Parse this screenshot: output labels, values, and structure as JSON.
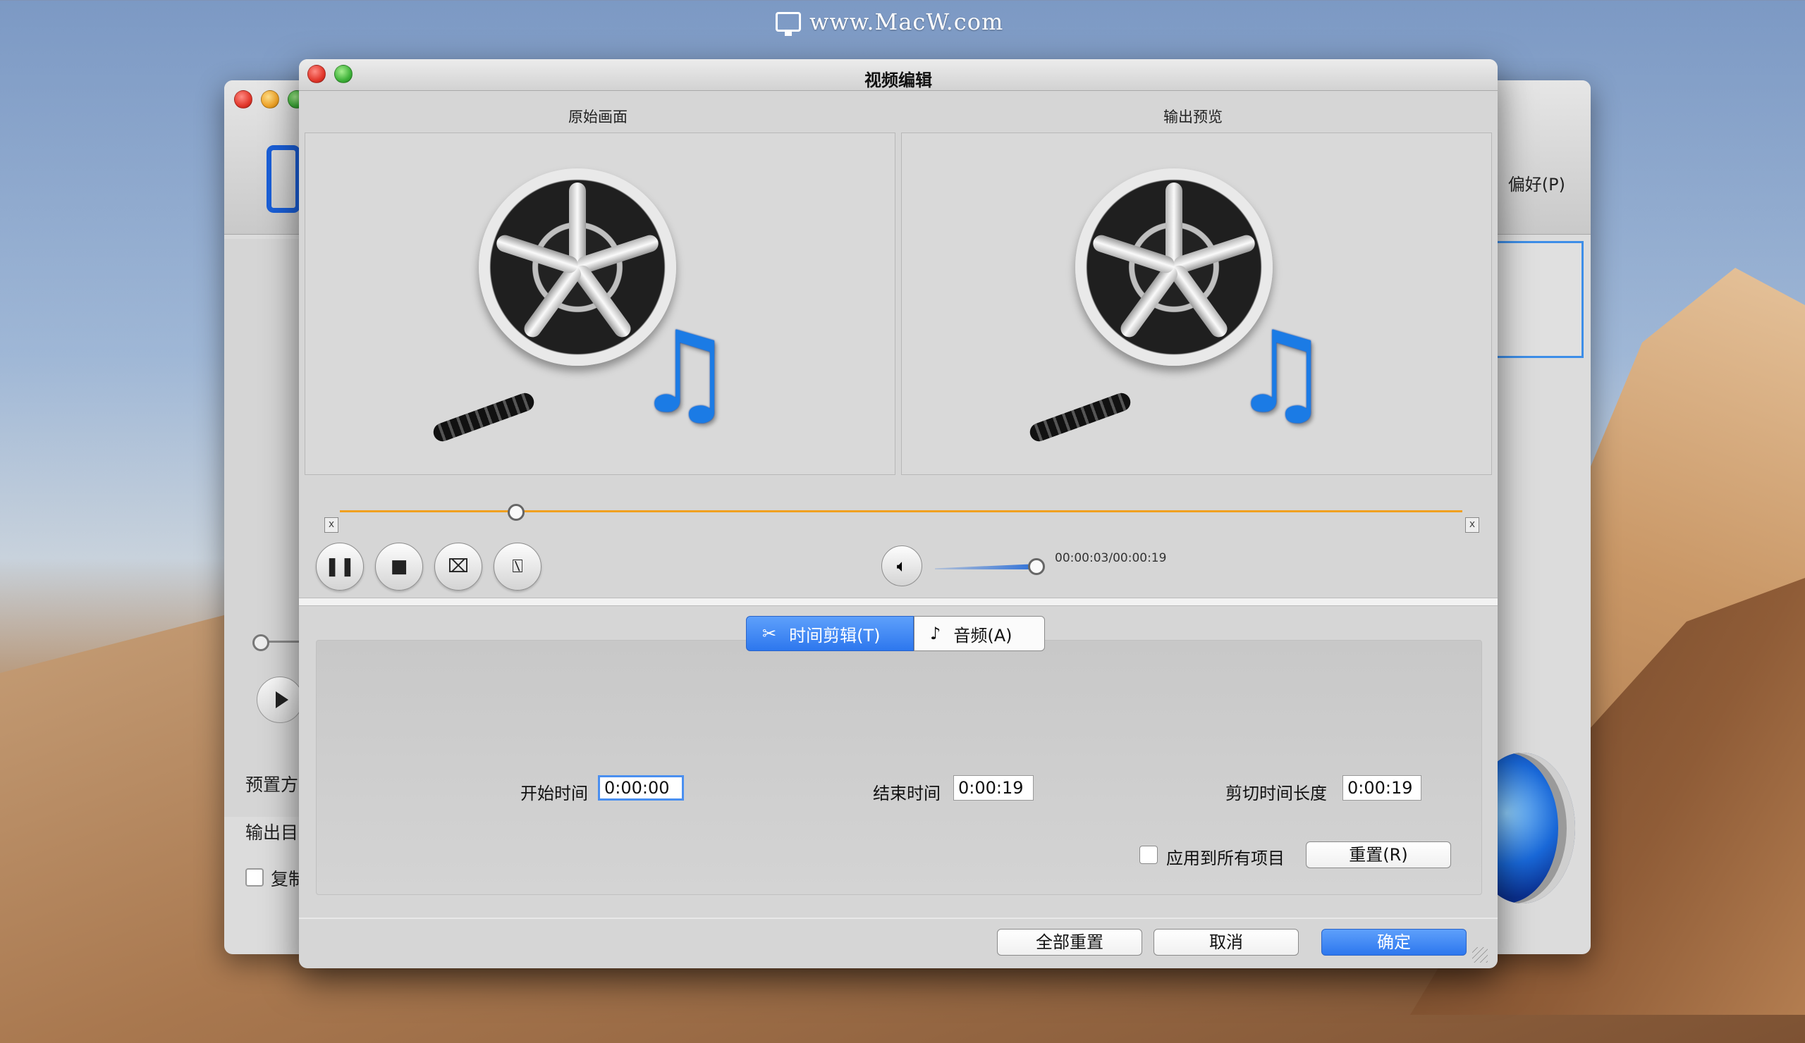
{
  "watermark": {
    "text": "www.MacW.com"
  },
  "background_window": {
    "preferences_label": "偏好(P)",
    "labels": [
      "预置方",
      "输出目",
      "复制"
    ]
  },
  "dialog": {
    "title": "视频编辑",
    "panes": {
      "original_label": "原始画面",
      "preview_label": "输出预览"
    },
    "seek": {
      "progress_fraction": 0.157
    },
    "trim_marker": "x",
    "controls": {
      "pause_icon": "pause-icon",
      "stop_icon": "stop-icon",
      "trim_start_icon": "trim-start-icon",
      "trim_end_icon": "trim-end-icon",
      "volume_icon": "speaker-icon",
      "volume_fraction": 0.95,
      "timecode": "00:00:03/00:00:19"
    },
    "tabs": [
      {
        "label": "时间剪辑(T)",
        "icon": "scissors-icon",
        "active": true
      },
      {
        "label": "音频(A)",
        "icon": "music-note-icon",
        "active": false
      }
    ],
    "trim_form": {
      "start_label": "开始时间",
      "start_value": "0:00:00",
      "end_label": "结束时间",
      "end_value": "0:00:19",
      "duration_label": "剪切时间长度",
      "duration_value": "0:00:19",
      "apply_all_label": "应用到所有项目",
      "reset_label": "重置(R)"
    },
    "footer": {
      "reset_all_label": "全部重置",
      "cancel_label": "取消",
      "ok_label": "确定"
    },
    "colors": {
      "accent": "#2d77ee",
      "seek": "#f0a020"
    }
  }
}
